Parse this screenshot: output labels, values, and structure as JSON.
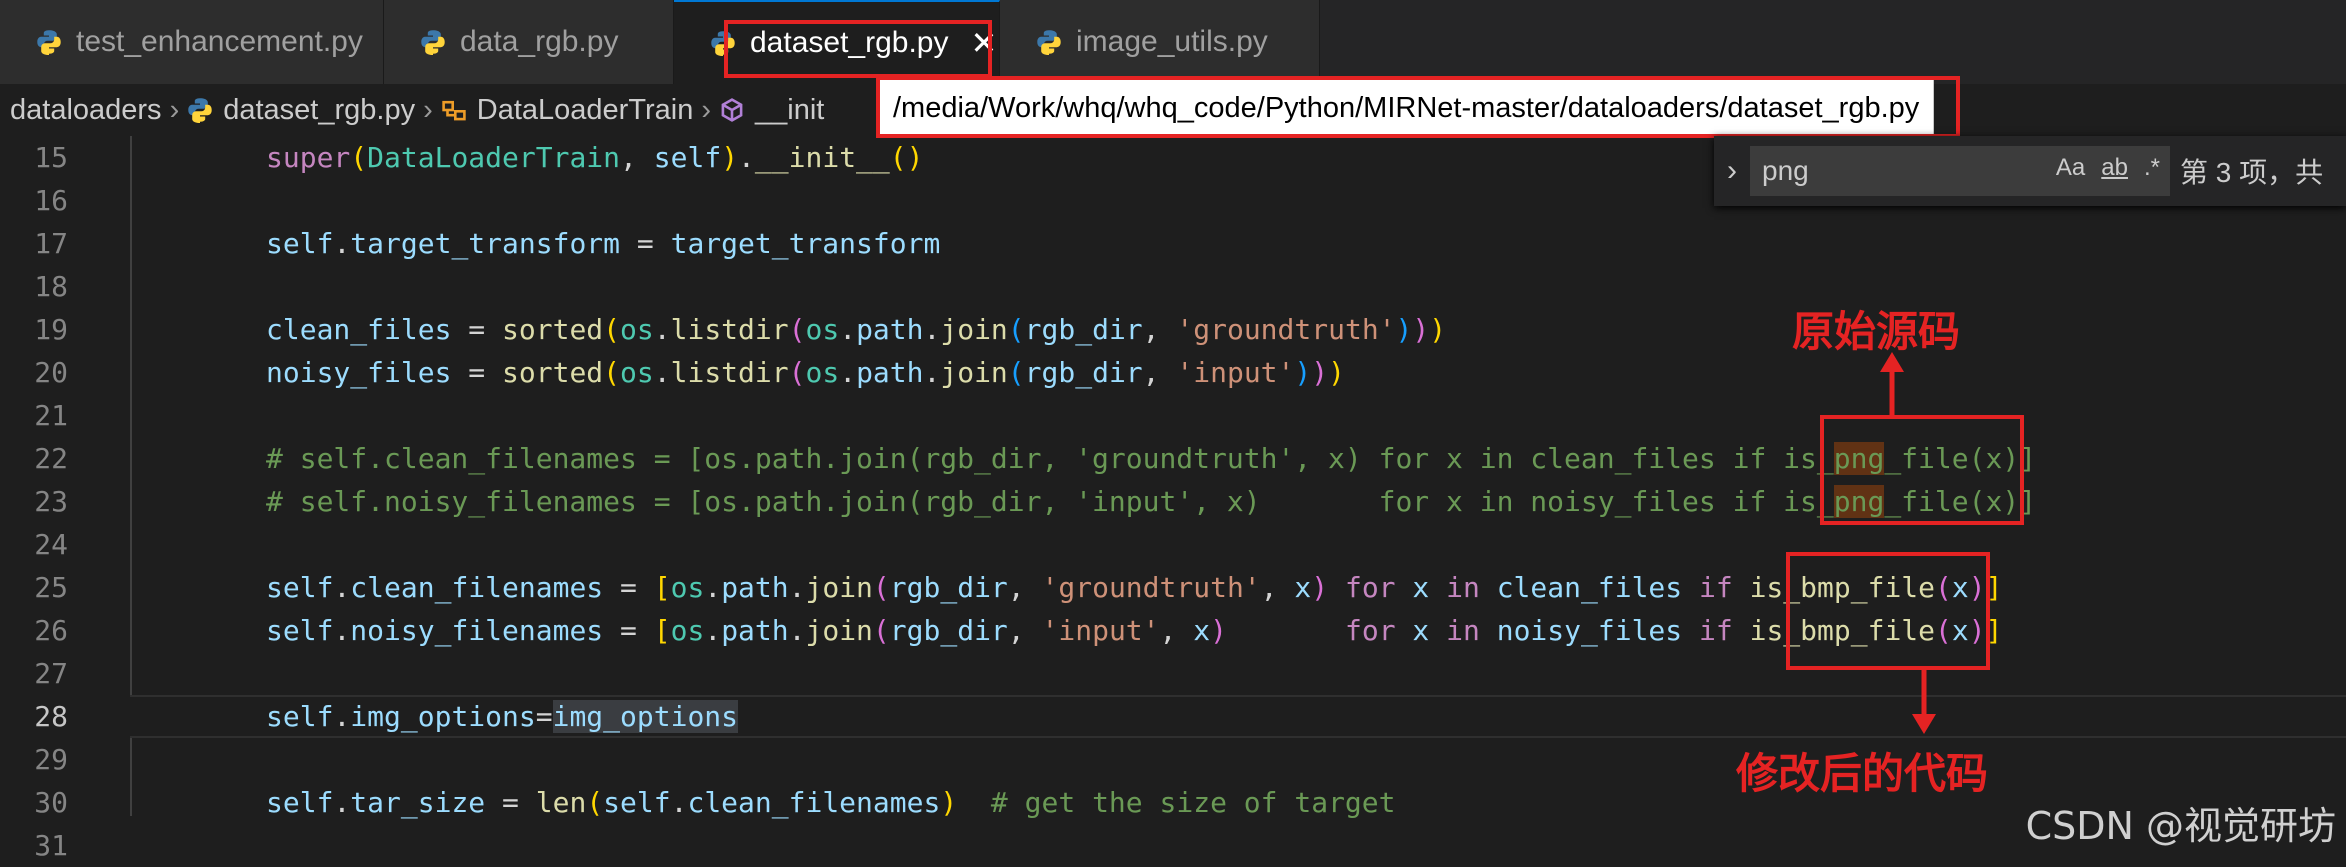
{
  "tabs": [
    {
      "label": "test_enhancement.py",
      "active": false
    },
    {
      "label": "data_rgb.py",
      "active": false
    },
    {
      "label": "dataset_rgb.py",
      "active": true
    },
    {
      "label": "image_utils.py",
      "active": false
    }
  ],
  "breadcrumb": {
    "folder": "dataloaders",
    "file": "dataset_rgb.py",
    "class": "DataLoaderTrain",
    "method": "__init"
  },
  "tooltip": "/media/Work/whq/whq_code/Python/MIRNet-master/dataloaders/dataset_rgb.py",
  "find": {
    "query": "png",
    "match_case": "Aa",
    "whole_word": "ab",
    "regex": ".*",
    "result": "第 3 项，共"
  },
  "line_numbers": [
    "15",
    "16",
    "17",
    "18",
    "19",
    "20",
    "21",
    "22",
    "23",
    "24",
    "25",
    "26",
    "27",
    "28",
    "29",
    "30",
    "31"
  ],
  "annotations": {
    "original": "原始源码",
    "modified": "修改后的代码"
  },
  "watermark": "CSDN @视觉研坊",
  "colors": {
    "annotation": "#e52323",
    "accent": "#0078d4",
    "background": "#1e1e1e"
  }
}
